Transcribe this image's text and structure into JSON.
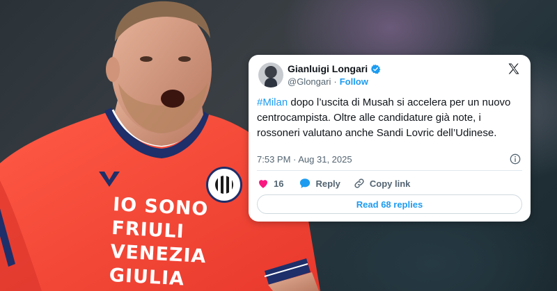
{
  "tweet": {
    "author_name": "Gianluigi Longari",
    "handle": "@Glongari",
    "separator": "·",
    "follow_label": "Follow",
    "hashtag": "#Milan",
    "text_body": " dopo l’uscita di Musah si accelera per un nuovo centrocampista. Oltre alle candidature già note, i rossoneri valutano anche Sandi Lovric dell’Udinese.",
    "timestamp": "7:53 PM · Aug 31, 2025",
    "like_count": "16",
    "reply_label": "Reply",
    "copy_link_label": "Copy link",
    "read_replies_label": "Read 68 replies"
  },
  "jersey": {
    "lines": [
      "IO SONO",
      "FRIULI",
      "VENEZIA",
      "GIULIA"
    ]
  },
  "icons": {
    "verified": "verified-badge-icon",
    "platform": "x-logo-icon",
    "info": "info-icon",
    "like": "heart-icon",
    "reply": "speech-bubble-icon",
    "link": "link-icon"
  },
  "colors": {
    "accent": "#1d9bf0",
    "jersey": "#ff4b3a",
    "text_primary": "#0f1419",
    "text_secondary": "#536471"
  }
}
